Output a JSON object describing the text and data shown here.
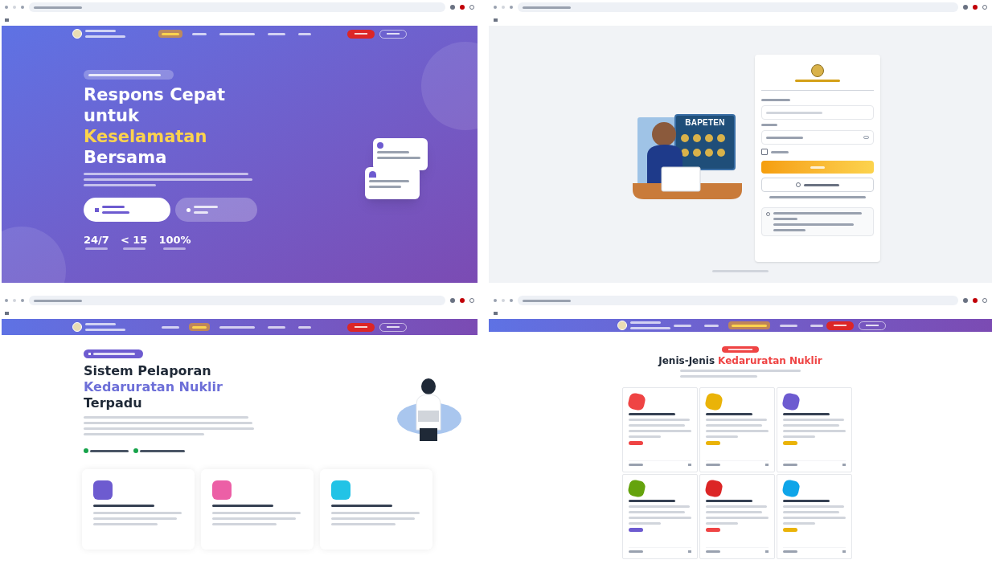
{
  "landing": {
    "nav_items": [
      {
        "selected": true
      },
      {
        "selected": false
      },
      {
        "selected": false
      },
      {
        "selected": false
      },
      {
        "selected": false
      }
    ],
    "title_lines": [
      {
        "text": "Respons Cepat",
        "highlight": false
      },
      {
        "text": "untuk",
        "highlight": false
      },
      {
        "text": "Keselamatan",
        "highlight": true
      },
      {
        "text": "Bersama",
        "highlight": false
      }
    ],
    "stats": [
      "24/7",
      "< 15",
      "100%"
    ]
  },
  "login": {
    "illustration_label": "BAPETEN",
    "remember_checked": false
  },
  "about": {
    "nav_items": [
      {
        "selected": false
      },
      {
        "selected": true
      },
      {
        "selected": false
      },
      {
        "selected": false
      },
      {
        "selected": false
      }
    ],
    "title_lines": [
      {
        "text": "Sistem Pelaporan",
        "highlight": false
      },
      {
        "text": "Kedaruratan Nuklir",
        "highlight": true
      },
      {
        "text": "Terpadu",
        "highlight": false
      }
    ],
    "features": [
      {
        "color": "#6d5bd0"
      },
      {
        "color": "#ec5fa6"
      },
      {
        "color": "#22c3e6"
      }
    ]
  },
  "types": {
    "nav_items": [
      {
        "selected": false
      },
      {
        "selected": false
      },
      {
        "selected": true
      },
      {
        "selected": false
      },
      {
        "selected": false
      }
    ],
    "title_lead": "Jenis-Jenis",
    "title_highlight": "Kedaruratan Nuklir",
    "cards": [
      {
        "color": "#ef4444",
        "tag": {
          "color": "#ef4444"
        }
      },
      {
        "color": "#eab308",
        "tag": {
          "color": "#eab308"
        }
      },
      {
        "color": "#6d5bd0",
        "tag": {
          "color": "#eab308"
        }
      },
      {
        "color": "#65a30d",
        "tag": {
          "color": "#6d5bd0"
        }
      },
      {
        "color": "#dc2626",
        "tag": {
          "color": "#ef4444"
        }
      },
      {
        "color": "#0ea5e9",
        "tag": {
          "color": "#eab308"
        }
      }
    ]
  }
}
